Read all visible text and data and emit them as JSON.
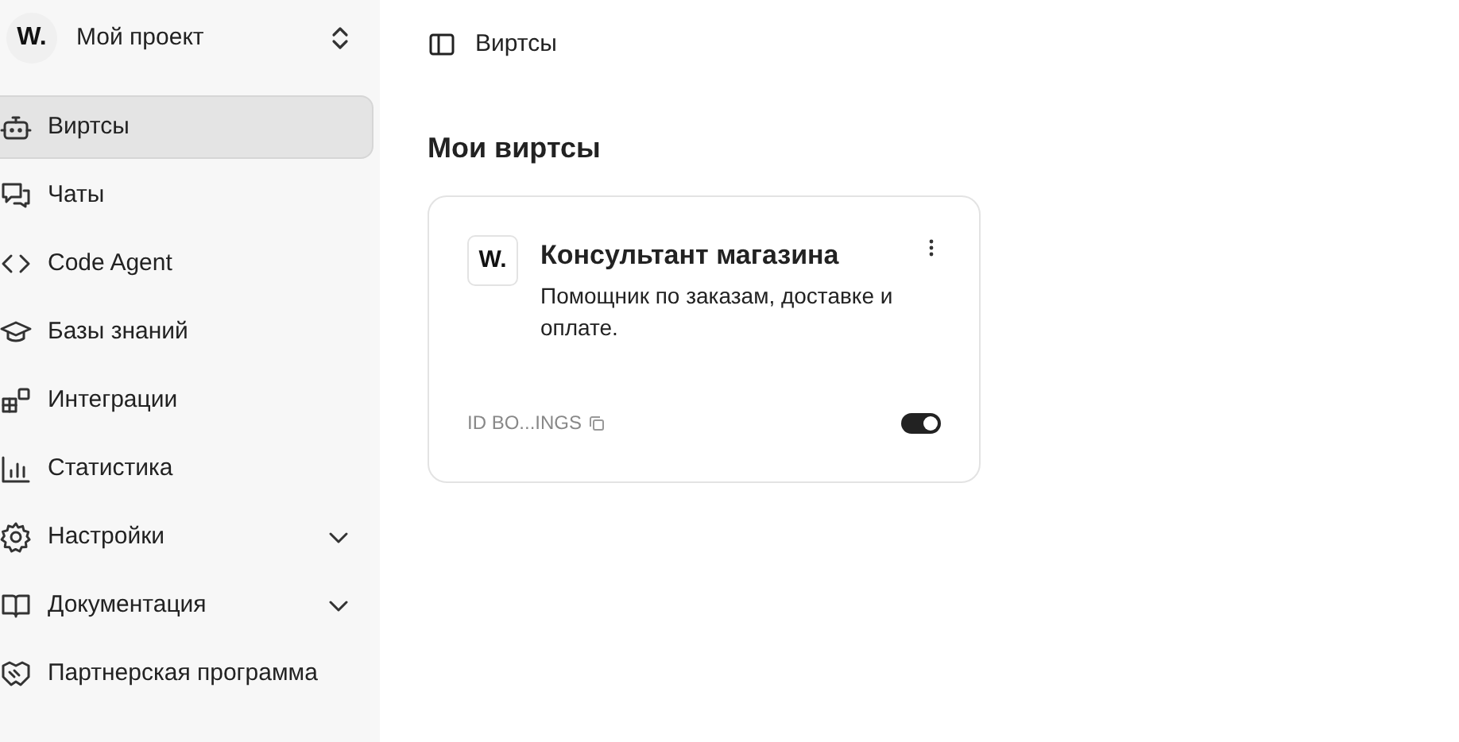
{
  "project": {
    "logo": "W.",
    "name": "Мой проект"
  },
  "sidebar": {
    "items": [
      {
        "kind": "bot",
        "label": "Виртсы",
        "selected": true,
        "expandable": false
      },
      {
        "kind": "chats",
        "label": "Чаты",
        "selected": false,
        "expandable": false
      },
      {
        "kind": "code",
        "label": "Code Agent",
        "selected": false,
        "expandable": false
      },
      {
        "kind": "school",
        "label": "Базы знаний",
        "selected": false,
        "expandable": false
      },
      {
        "kind": "integrations",
        "label": "Интеграции",
        "selected": false,
        "expandable": false
      },
      {
        "kind": "stats",
        "label": "Статистика",
        "selected": false,
        "expandable": false
      },
      {
        "kind": "settings",
        "label": "Настройки",
        "selected": false,
        "expandable": true
      },
      {
        "kind": "docs",
        "label": "Документация",
        "selected": false,
        "expandable": true
      },
      {
        "kind": "partner",
        "label": "Партнерская программа",
        "selected": false,
        "expandable": false
      }
    ]
  },
  "breadcrumb": "Виртсы",
  "heading": "Мои виртсы",
  "cards": [
    {
      "logo": "W.",
      "title": "Консультант магазина",
      "description": "Помощник по заказам, доставке и оплате.",
      "id": "ID BO...INGS",
      "on": true
    }
  ]
}
